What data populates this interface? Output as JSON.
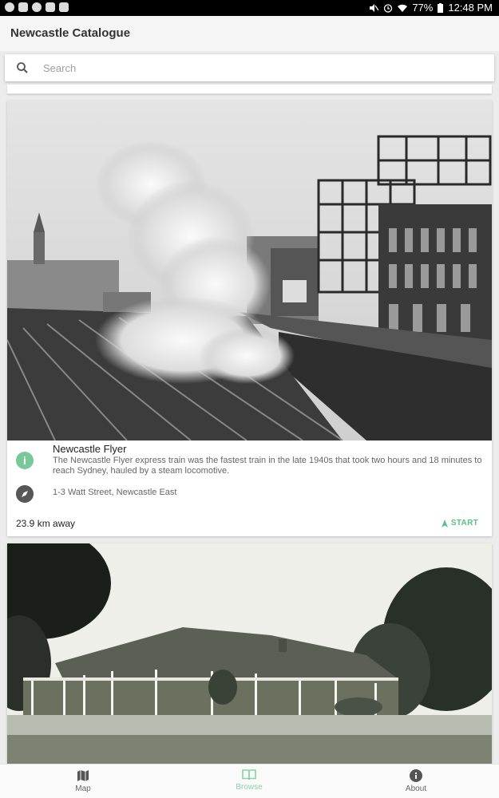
{
  "status_bar": {
    "battery": "77%",
    "time": "12:48 PM"
  },
  "app": {
    "title": "Newcastle Catalogue"
  },
  "search": {
    "placeholder": "Search"
  },
  "cards": [
    {
      "title": "Newcastle Flyer",
      "description": "The Newcastle Flyer express train was the fastest train in the late 1940s that took two hours and 18 minutes to reach Sydney, hauled by a steam locomotive.",
      "address": "1-3 Watt Street, Newcastle East",
      "distance": "23.9 km away",
      "action_label": "START"
    }
  ],
  "bottom_nav": {
    "items": [
      {
        "label": "Map",
        "icon": "map-icon"
      },
      {
        "label": "Browse",
        "icon": "book-icon",
        "active": true
      },
      {
        "label": "About",
        "icon": "info-icon"
      }
    ]
  },
  "colors": {
    "accent": "#58c085",
    "info_icon_bg": "#78c89a",
    "compass_icon_bg": "#575757"
  }
}
